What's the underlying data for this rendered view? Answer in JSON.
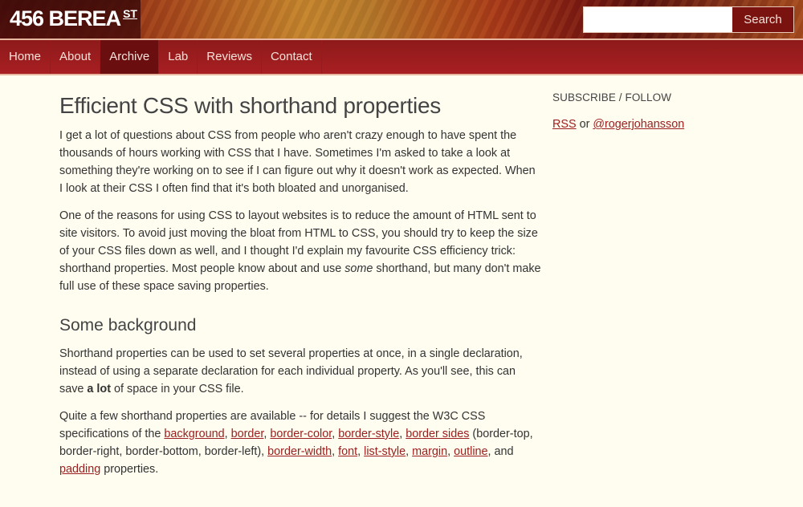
{
  "header": {
    "logo_text": "456 BEREA",
    "logo_sup": "ST",
    "search": {
      "value": "",
      "placeholder": "",
      "button_label": "Search"
    }
  },
  "nav": {
    "items": [
      {
        "label": "Home",
        "active": false
      },
      {
        "label": "About",
        "active": false
      },
      {
        "label": "Archive",
        "active": true
      },
      {
        "label": "Lab",
        "active": false
      },
      {
        "label": "Reviews",
        "active": false
      },
      {
        "label": "Contact",
        "active": false
      }
    ]
  },
  "article": {
    "title": "Efficient CSS with shorthand properties",
    "p1": "I get a lot of questions about CSS from people who aren't crazy enough to have spent the thousands of hours working with CSS that I have. Sometimes I'm asked to take a look at something they're working on to see if I can figure out why it doesn't work as expected. When I look at their CSS I often find that it's both bloated and unorganised.",
    "p2": {
      "before": "One of the reasons for using CSS to layout websites is to reduce the amount of HTML sent to site visitors. To avoid just moving the bloat from HTML to CSS, you should try to keep the size of your CSS files down as well, and I thought I'd explain my favourite CSS efficiency trick: shorthand properties. Most people know about and use ",
      "em": "some",
      "after": " shorthand, but many don't make full use of these space saving properties."
    },
    "h2": "Some background",
    "p3": {
      "before": "Shorthand properties can be used to set several properties at once, in a single declaration, instead of using a separate declaration for each individual property. As you'll see, this can save ",
      "strong": "a lot",
      "after": " of space in your CSS file."
    },
    "p4": {
      "intro": "Quite a few shorthand properties are available -- for details I suggest the W3C CSS specifications of the ",
      "links": [
        "background",
        "border",
        "border-color",
        "border-style",
        "border sides",
        "border-width",
        "font",
        "list-style",
        "margin",
        "outline",
        "padding"
      ],
      "sep_comma": ", ",
      "border_sides_note": " (border-top, border-right, border-bottom, border-left), ",
      "and": ", and ",
      "end": " properties."
    }
  },
  "sidebar": {
    "heading": "SUBSCRIBE / FOLLOW",
    "rss_label": "RSS",
    "or": " or ",
    "twitter_label": "@rogerjohansson"
  },
  "colors": {
    "link": "#9b1d1d",
    "nav_bg": "#a81f22",
    "nav_active": "#6a0e10",
    "page_bg": "#fffdf0"
  }
}
